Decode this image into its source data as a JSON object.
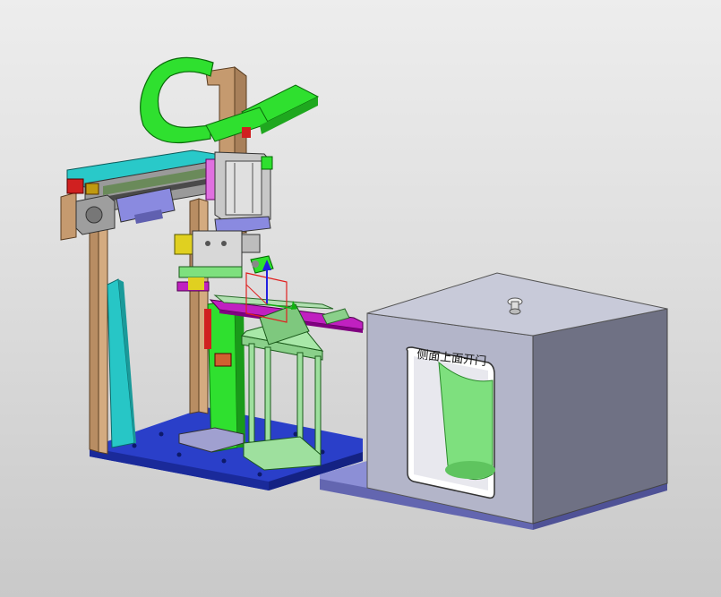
{
  "scene": {
    "description_label": "",
    "enclosure_label": "侧面上面开门",
    "colors": {
      "background_top": "#ededed",
      "background_bottom": "#c9c9c9",
      "base_plate": "#2a3fc9",
      "frame_tan": "#c59a6f",
      "hose_green": "#2fe02f",
      "enclosure_front": "#b3b5c9",
      "enclosure_side": "#6f7184",
      "enclosure_top": "#c8cad9",
      "cyan_part": "#27c6c6",
      "rail_magenta": "#c020c0",
      "inner_green": "#7ee07e"
    }
  }
}
